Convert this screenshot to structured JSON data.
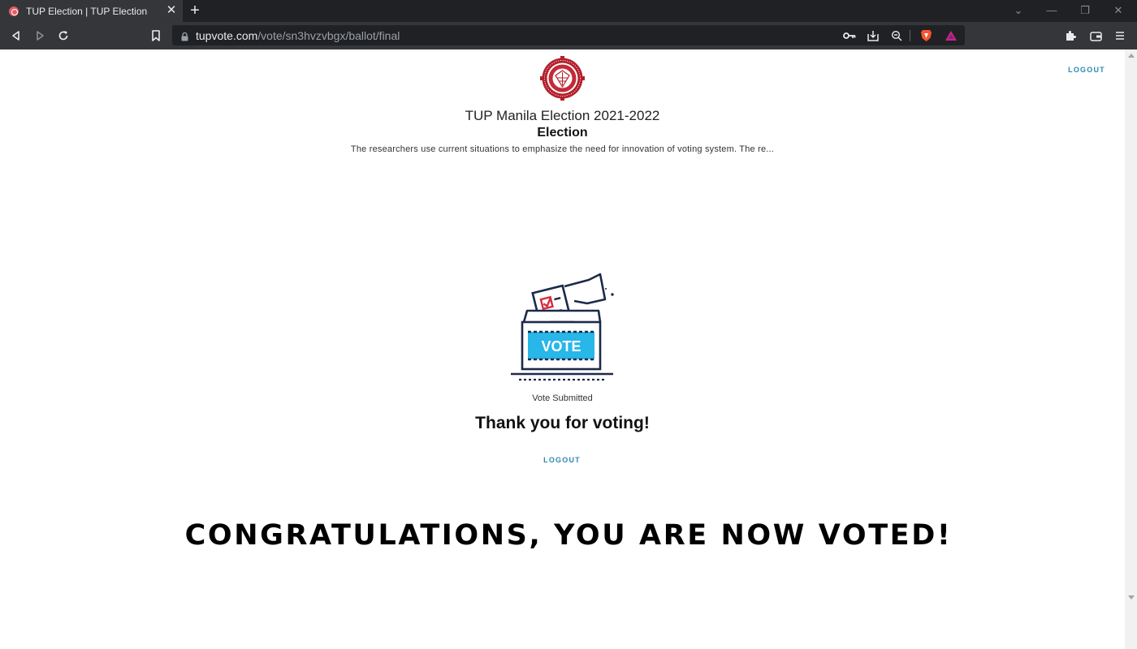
{
  "browser": {
    "tab_title": "TUP Election | TUP Election",
    "tab_close": "✕",
    "new_tab": "+",
    "url_domain": "tupvote.com",
    "url_path": "/vote/sn3hvzvbgx/ballot/final",
    "window_controls": {
      "dropdown": "⌄",
      "minimize": "—",
      "restore": "❐",
      "close": "✕"
    },
    "icons": [
      "back-icon",
      "forward-icon",
      "reload-icon",
      "bookmark-icon",
      "lock-icon",
      "key-icon",
      "install-icon",
      "zoom-icon",
      "brave-shield-icon",
      "brave-rewards-icon",
      "extensions-icon",
      "wallet-icon",
      "menu-icon"
    ]
  },
  "header": {
    "logout_label": "LOGOUT",
    "election_name": "TUP Manila Election 2021-2022",
    "election_subtitle": "Election",
    "description": "The researchers use current situations to emphasize the need for innovation of voting system. The re..."
  },
  "main": {
    "ballot_box_label": "VOTE",
    "status": "Vote Submitted",
    "thanks": "Thank you for voting!",
    "logout_label": "LOGOUT"
  },
  "banner": {
    "text": "CONGRATULATIONS, YOU ARE NOW VOTED!"
  },
  "colors": {
    "accent": "#2b88b3",
    "ballot_blue": "#29b6e8",
    "navy": "#1c2a4a",
    "check_red": "#d62d3b",
    "logo_red": "#b3202c"
  }
}
